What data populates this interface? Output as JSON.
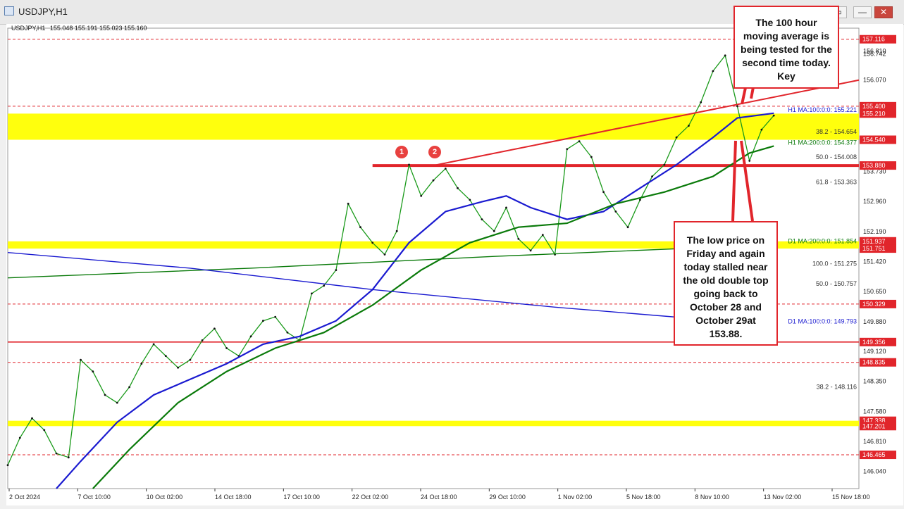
{
  "window": {
    "title": "USDJPY,H1",
    "buttons": [
      "_",
      "▢",
      "✕",
      "▭",
      "—",
      "✕"
    ]
  },
  "info_bar": {
    "symbol": "USDJPY,H1",
    "ohlc": "155.048 155.191 155.023 155.160"
  },
  "annotations": {
    "callout_top": "The 100 hour moving average is being tested for the second time today.  Key",
    "callout_bottom": "The low price on Friday and again today stalled near the old double top going back to October 28 and October 29at 153.88.",
    "marker_1": "1",
    "marker_2": "2"
  },
  "chart_data": {
    "type": "line",
    "symbol": "USDJPY",
    "timeframe": "H1",
    "ylim": [
      145.6,
      157.4
    ],
    "x_ticks": [
      "2 Oct 2024",
      "7 Oct 10:00",
      "10 Oct 02:00",
      "14 Oct 18:00",
      "17 Oct 10:00",
      "22 Oct 02:00",
      "24 Oct 18:00",
      "29 Oct 10:00",
      "1 Nov 02:00",
      "5 Nov 18:00",
      "8 Nov 10:00",
      "13 Nov 02:00",
      "15 Nov 18:00"
    ],
    "y_ticks": [
      157.116,
      156.81,
      156.742,
      156.07,
      155.4,
      155.21,
      154.54,
      153.88,
      153.73,
      152.96,
      152.19,
      151.937,
      151.751,
      151.42,
      150.65,
      150.329,
      149.88,
      149.356,
      149.12,
      148.835,
      148.35,
      147.58,
      147.338,
      147.201,
      146.81,
      146.465,
      146.04
    ],
    "axis_boxes": [
      {
        "value": 157.116,
        "label": "157.116",
        "color": "#e1252b"
      },
      {
        "value": 155.4,
        "label": "155.400",
        "color": "#e1252b"
      },
      {
        "value": 155.21,
        "label": "155.210",
        "color": "#e1252b"
      },
      {
        "value": 154.54,
        "label": "154.540",
        "color": "#e1252b"
      },
      {
        "value": 153.88,
        "label": "153.880",
        "color": "#e1252b"
      },
      {
        "value": 151.937,
        "label": "151.937",
        "color": "#e1252b"
      },
      {
        "value": 151.751,
        "label": "151.751",
        "color": "#e1252b"
      },
      {
        "value": 150.329,
        "label": "150.329",
        "color": "#e1252b"
      },
      {
        "value": 149.356,
        "label": "149.356",
        "color": "#e1252b"
      },
      {
        "value": 148.835,
        "label": "148.835",
        "color": "#e1252b"
      },
      {
        "value": 147.338,
        "label": "147.338",
        "color": "#e1252b"
      },
      {
        "value": 147.201,
        "label": "147.201",
        "color": "#e1252b"
      },
      {
        "value": 146.465,
        "label": "146.465",
        "color": "#e1252b"
      }
    ],
    "axis_plain": [
      {
        "value": 156.81,
        "label": "156.810"
      },
      {
        "value": 156.742,
        "label": "156.742"
      },
      {
        "value": 156.07,
        "label": "156.070"
      },
      {
        "value": 153.73,
        "label": "153.730"
      },
      {
        "value": 152.96,
        "label": "152.960"
      },
      {
        "value": 152.19,
        "label": "152.190"
      },
      {
        "value": 151.42,
        "label": "151.420"
      },
      {
        "value": 150.65,
        "label": "150.650"
      },
      {
        "value": 149.88,
        "label": "149.880"
      },
      {
        "value": 149.12,
        "label": "149.120"
      },
      {
        "value": 148.35,
        "label": "148.350"
      },
      {
        "value": 147.58,
        "label": "147.580"
      },
      {
        "value": 146.81,
        "label": "146.810"
      },
      {
        "value": 146.04,
        "label": "146.040"
      }
    ],
    "zones": [
      {
        "from": 154.54,
        "to": 155.21,
        "color": "#ffff00"
      },
      {
        "from": 151.751,
        "to": 151.937,
        "color": "#ffff00"
      },
      {
        "from": 147.201,
        "to": 147.338,
        "color": "#ffff00"
      }
    ],
    "horizontal_lines": [
      {
        "value": 153.88,
        "color": "#e1252b",
        "style": "thick"
      },
      {
        "value": 149.356,
        "color": "#e1252b",
        "style": "solid"
      },
      {
        "value": 157.116,
        "color": "#e1252b",
        "style": "dashed"
      },
      {
        "value": 155.4,
        "color": "#e1252b",
        "style": "dashed"
      },
      {
        "value": 150.329,
        "color": "#e1252b",
        "style": "dashed"
      },
      {
        "value": 148.835,
        "color": "#e1252b",
        "style": "dashed"
      },
      {
        "value": 146.465,
        "color": "#e1252b",
        "style": "dashed"
      }
    ],
    "level_labels": [
      {
        "text": "38.2 - 154.654",
        "value": 154.654,
        "color": "#333333"
      },
      {
        "text": "50.0 - 154.008",
        "value": 154.008,
        "color": "#333333"
      },
      {
        "text": "61.8 - 153.363",
        "value": 153.363,
        "color": "#333333"
      },
      {
        "text": "100.0 - 151.275",
        "value": 151.275,
        "color": "#333333"
      },
      {
        "text": "50.0 - 150.757",
        "value": 150.757,
        "color": "#333333"
      },
      {
        "text": "38.2 - 148.116",
        "value": 148.116,
        "color": "#333333"
      },
      {
        "text": "H1 MA:100:0:0: 155.221",
        "value": 155.221,
        "color": "#1a1ad0"
      },
      {
        "text": "H1 MA:200:0:0: 154.377",
        "value": 154.377,
        "color": "#0a7a0a"
      },
      {
        "text": "D1 MA:200:0:0: 151.854",
        "value": 151.854,
        "color": "#0a7a0a"
      },
      {
        "text": "D1 MA:100:0:0: 149.793",
        "value": 149.793,
        "color": "#1a1ad0"
      }
    ],
    "price_series": [
      {
        "x": 0,
        "y": 146.2
      },
      {
        "x": 1,
        "y": 146.9
      },
      {
        "x": 2,
        "y": 147.4
      },
      {
        "x": 3,
        "y": 147.1
      },
      {
        "x": 4,
        "y": 146.5
      },
      {
        "x": 5,
        "y": 146.4
      },
      {
        "x": 6,
        "y": 148.9
      },
      {
        "x": 7,
        "y": 148.6
      },
      {
        "x": 8,
        "y": 148.0
      },
      {
        "x": 9,
        "y": 147.8
      },
      {
        "x": 10,
        "y": 148.2
      },
      {
        "x": 11,
        "y": 148.8
      },
      {
        "x": 12,
        "y": 149.3
      },
      {
        "x": 13,
        "y": 149.0
      },
      {
        "x": 14,
        "y": 148.7
      },
      {
        "x": 15,
        "y": 148.9
      },
      {
        "x": 16,
        "y": 149.4
      },
      {
        "x": 17,
        "y": 149.7
      },
      {
        "x": 18,
        "y": 149.2
      },
      {
        "x": 19,
        "y": 149.0
      },
      {
        "x": 20,
        "y": 149.5
      },
      {
        "x": 21,
        "y": 149.9
      },
      {
        "x": 22,
        "y": 150.0
      },
      {
        "x": 23,
        "y": 149.6
      },
      {
        "x": 24,
        "y": 149.4
      },
      {
        "x": 25,
        "y": 150.6
      },
      {
        "x": 26,
        "y": 150.8
      },
      {
        "x": 27,
        "y": 151.2
      },
      {
        "x": 28,
        "y": 152.9
      },
      {
        "x": 29,
        "y": 152.3
      },
      {
        "x": 30,
        "y": 151.9
      },
      {
        "x": 31,
        "y": 151.6
      },
      {
        "x": 32,
        "y": 152.2
      },
      {
        "x": 33,
        "y": 153.9
      },
      {
        "x": 34,
        "y": 153.1
      },
      {
        "x": 35,
        "y": 153.5
      },
      {
        "x": 36,
        "y": 153.8
      },
      {
        "x": 37,
        "y": 153.3
      },
      {
        "x": 38,
        "y": 153.0
      },
      {
        "x": 39,
        "y": 152.5
      },
      {
        "x": 40,
        "y": 152.2
      },
      {
        "x": 41,
        "y": 152.8
      },
      {
        "x": 42,
        "y": 152.0
      },
      {
        "x": 43,
        "y": 151.7
      },
      {
        "x": 44,
        "y": 152.1
      },
      {
        "x": 45,
        "y": 151.6
      },
      {
        "x": 46,
        "y": 154.3
      },
      {
        "x": 47,
        "y": 154.5
      },
      {
        "x": 48,
        "y": 154.1
      },
      {
        "x": 49,
        "y": 153.2
      },
      {
        "x": 50,
        "y": 152.7
      },
      {
        "x": 51,
        "y": 152.3
      },
      {
        "x": 52,
        "y": 153.0
      },
      {
        "x": 53,
        "y": 153.6
      },
      {
        "x": 54,
        "y": 153.9
      },
      {
        "x": 55,
        "y": 154.6
      },
      {
        "x": 56,
        "y": 154.9
      },
      {
        "x": 57,
        "y": 155.5
      },
      {
        "x": 58,
        "y": 156.3
      },
      {
        "x": 59,
        "y": 156.7
      },
      {
        "x": 60,
        "y": 155.4
      },
      {
        "x": 61,
        "y": 154.0
      },
      {
        "x": 62,
        "y": 154.8
      },
      {
        "x": 63,
        "y": 155.16
      }
    ],
    "series": [
      {
        "values": [
          {
            "x": 4,
            "y": 145.6
          },
          {
            "x": 6,
            "y": 146.3
          },
          {
            "x": 9,
            "y": 147.3
          },
          {
            "x": 12,
            "y": 148.0
          },
          {
            "x": 15,
            "y": 148.4
          },
          {
            "x": 18,
            "y": 148.8
          },
          {
            "x": 21,
            "y": 149.3
          },
          {
            "x": 24,
            "y": 149.5
          },
          {
            "x": 27,
            "y": 149.9
          },
          {
            "x": 30,
            "y": 150.7
          },
          {
            "x": 33,
            "y": 151.9
          },
          {
            "x": 36,
            "y": 152.7
          },
          {
            "x": 39,
            "y": 152.95
          },
          {
            "x": 41,
            "y": 153.1
          },
          {
            "x": 43,
            "y": 152.8
          },
          {
            "x": 46,
            "y": 152.5
          },
          {
            "x": 49,
            "y": 152.7
          },
          {
            "x": 52,
            "y": 153.3
          },
          {
            "x": 55,
            "y": 153.9
          },
          {
            "x": 58,
            "y": 154.6
          },
          {
            "x": 60,
            "y": 155.1
          },
          {
            "x": 63,
            "y": 155.22
          }
        ],
        "color": "#1a1ad0"
      },
      {
        "values": [
          {
            "x": 7,
            "y": 145.6
          },
          {
            "x": 10,
            "y": 146.6
          },
          {
            "x": 14,
            "y": 147.8
          },
          {
            "x": 18,
            "y": 148.6
          },
          {
            "x": 22,
            "y": 149.2
          },
          {
            "x": 26,
            "y": 149.6
          },
          {
            "x": 30,
            "y": 150.3
          },
          {
            "x": 34,
            "y": 151.2
          },
          {
            "x": 38,
            "y": 151.9
          },
          {
            "x": 42,
            "y": 152.3
          },
          {
            "x": 46,
            "y": 152.4
          },
          {
            "x": 50,
            "y": 152.9
          },
          {
            "x": 54,
            "y": 153.2
          },
          {
            "x": 58,
            "y": 153.6
          },
          {
            "x": 61,
            "y": 154.2
          },
          {
            "x": 63,
            "y": 154.38
          }
        ],
        "color": "#0a7a0a"
      },
      {
        "values": [
          {
            "x": 0,
            "y": 151.0
          },
          {
            "x": 20,
            "y": 151.25
          },
          {
            "x": 40,
            "y": 151.55
          },
          {
            "x": 63,
            "y": 151.85
          }
        ],
        "color": "#0a7a0a"
      },
      {
        "values": [
          {
            "x": 0,
            "y": 151.65
          },
          {
            "x": 15,
            "y": 151.25
          },
          {
            "x": 30,
            "y": 150.7
          },
          {
            "x": 45,
            "y": 150.25
          },
          {
            "x": 63,
            "y": 149.79
          }
        ],
        "color": "#1a1ad0"
      }
    ],
    "trend_lines": [
      {
        "from": {
          "x": 35,
          "y": 153.88
        },
        "to": {
          "x": 70,
          "y": 156.07
        },
        "color": "#e1252b"
      }
    ],
    "x_max": 70
  }
}
